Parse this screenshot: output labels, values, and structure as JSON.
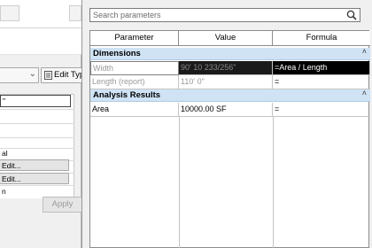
{
  "background_window": {
    "type_label": "",
    "edit_type_label": "Edit Typ",
    "instance_value": "\"",
    "rows": [
      "al",
      "Edit...",
      "Edit...",
      "n"
    ],
    "apply_label": "Apply"
  },
  "dialog": {
    "search_placeholder": "Search parameters",
    "columns": [
      "Parameter",
      "Value",
      "Formula"
    ],
    "groups": [
      {
        "name": "Dimensions",
        "rows": [
          {
            "parameter": "Width",
            "value": "90'  10 233/256\"",
            "formula": "=Area / Length"
          },
          {
            "parameter": "Length (report)",
            "value": "110'  0\"",
            "formula": "="
          }
        ]
      },
      {
        "name": "Analysis Results",
        "rows": [
          {
            "parameter": "Area",
            "value": "10000.00 SF",
            "formula": "="
          }
        ]
      }
    ]
  },
  "colors": {
    "group_header": "#cfe3f5",
    "selected_value_bg": "#1a1a1a",
    "formula_highlight": "#000000"
  }
}
